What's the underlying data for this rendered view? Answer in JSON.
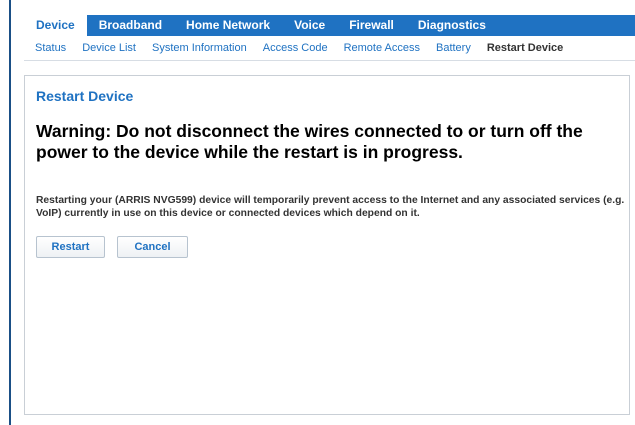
{
  "top_nav": {
    "tabs": [
      "Device",
      "Broadband",
      "Home Network",
      "Voice",
      "Firewall",
      "Diagnostics"
    ],
    "active": "Device"
  },
  "sub_nav": {
    "items": [
      "Status",
      "Device List",
      "System Information",
      "Access Code",
      "Remote Access",
      "Battery",
      "Restart Device"
    ],
    "active": "Restart Device"
  },
  "page": {
    "title": "Restart Device",
    "warning": "Warning: Do not disconnect the wires connected to or turn off the power to the device while the restart is in progress.",
    "description": "Restarting your (ARRIS NVG599) device will temporarily prevent access to the Internet and any associated services (e.g. VoIP) currently in use on this device or connected devices which depend on it."
  },
  "buttons": {
    "restart": "Restart",
    "cancel": "Cancel"
  },
  "colors": {
    "accent": "#1f72c2",
    "frame_rule": "#1a4f86"
  }
}
